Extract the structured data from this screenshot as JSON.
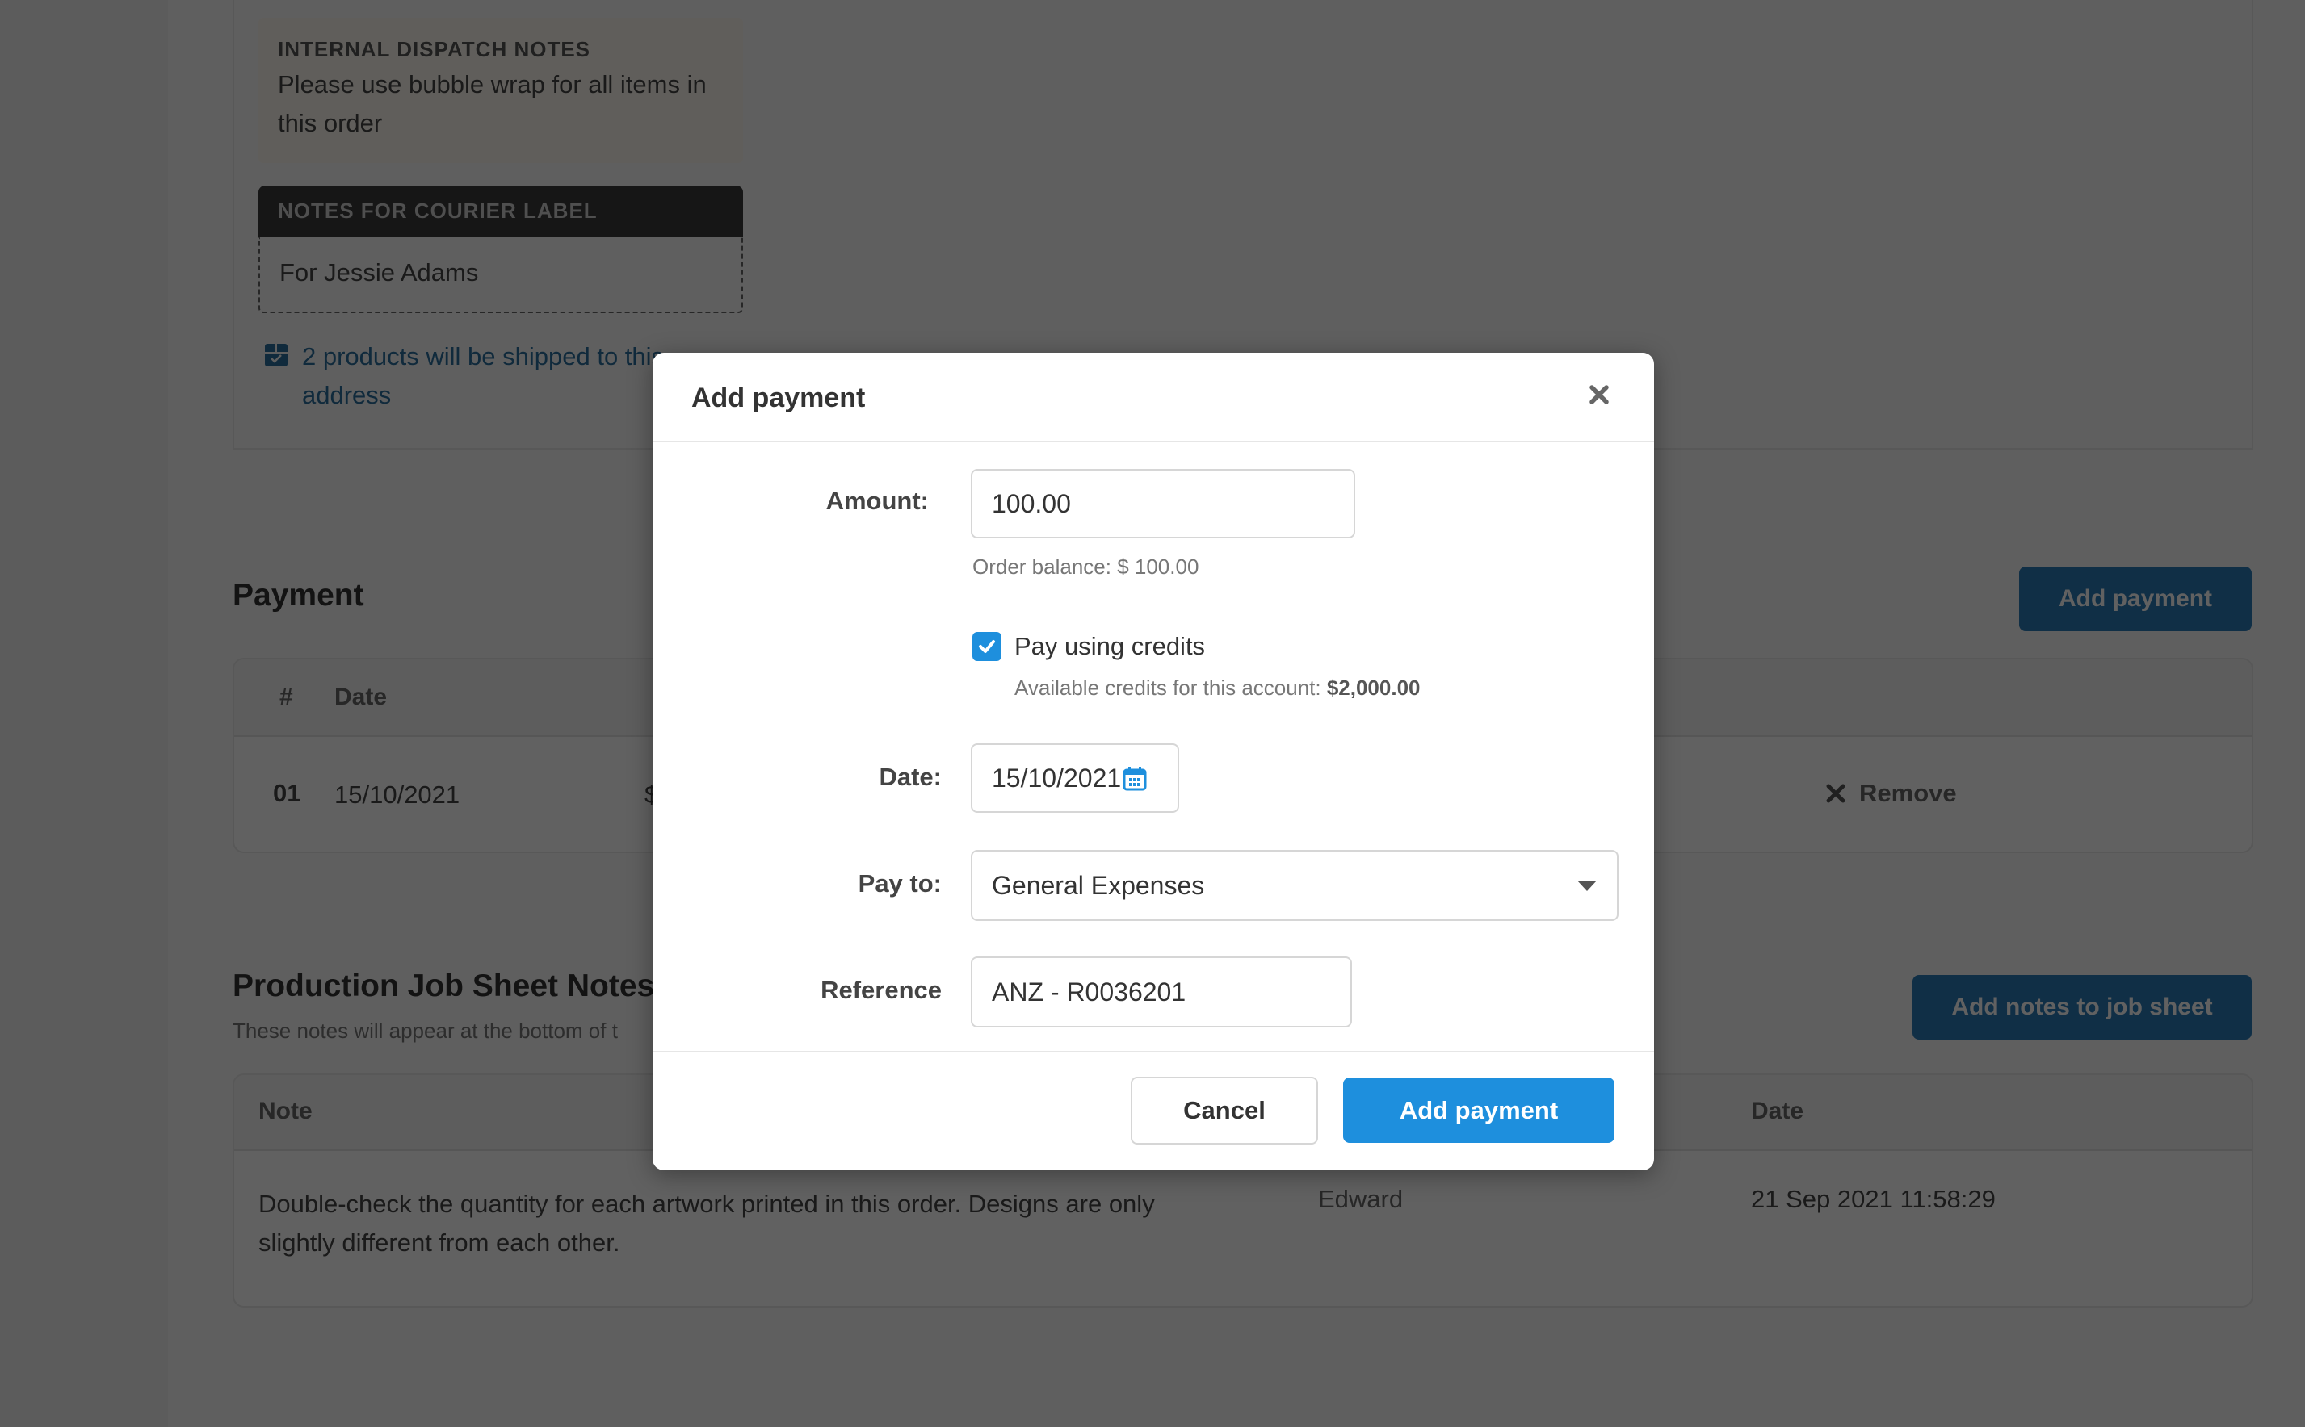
{
  "background": {
    "dispatch_notes": {
      "title": "INTERNAL DISPATCH NOTES",
      "text": "Please use bubble wrap for all items in this order"
    },
    "courier_label": {
      "title": "NOTES FOR COURIER LABEL",
      "text": "For Jessie Adams"
    },
    "shipping_info": {
      "icon": "box-check-icon",
      "text": "2 products will be shipped to this address"
    },
    "payment": {
      "title": "Payment",
      "add_button": "Add payment",
      "columns": [
        "#",
        "Date"
      ],
      "rows": [
        {
          "index": "01",
          "date": "15/10/2021",
          "amount_partial": "$",
          "action": "Remove"
        }
      ]
    },
    "job_sheet_notes": {
      "title": "Production Job Sheet Notes",
      "subtitle": "These notes will appear at the bottom of t",
      "add_button": "Add notes to job sheet",
      "columns": [
        "Note",
        "Date"
      ],
      "rows": [
        {
          "note": "Double-check the quantity for each artwork printed in this order. Designs are only slightly different from each other.",
          "author": "Edward",
          "date": "21 Sep 2021 11:58:29"
        }
      ]
    }
  },
  "modal": {
    "title": "Add payment",
    "close_icon": "close-icon",
    "amount": {
      "label": "Amount:",
      "value": "100.00",
      "helper": "Order balance: $ 100.00"
    },
    "credits": {
      "checked": true,
      "label": "Pay using credits",
      "helper_prefix": "Available credits for this account: ",
      "helper_value": "$2,000.00"
    },
    "date": {
      "label": "Date:",
      "value": "15/10/2021",
      "icon": "calendar-icon"
    },
    "pay_to": {
      "label": "Pay to:",
      "selected": "General Expenses"
    },
    "reference": {
      "label": "Reference",
      "value": "ANZ - R0036201"
    },
    "cancel_label": "Cancel",
    "submit_label": "Add payment"
  },
  "colors": {
    "primary": "#1e8fdd",
    "link": "#2b6f9e",
    "overlay": "rgba(0,0,0,0.62)"
  }
}
